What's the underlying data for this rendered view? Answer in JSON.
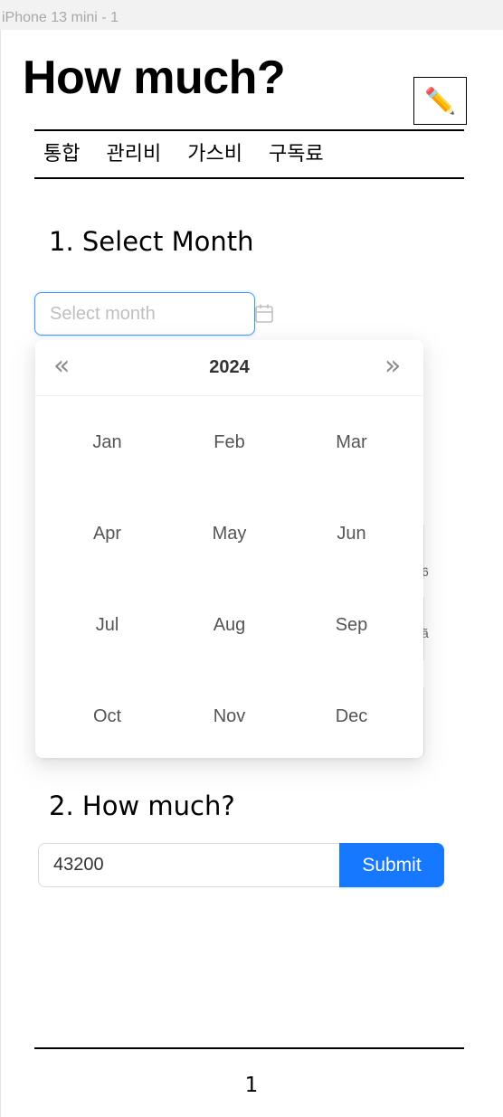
{
  "frame_label": "iPhone 13 mini - 1",
  "header": {
    "title": "How much?",
    "edit_icon": "pencil-icon",
    "edit_glyph": "✏️"
  },
  "nav": {
    "items": [
      "통합",
      "관리비",
      "가스비",
      "구독료"
    ]
  },
  "section1": {
    "title": "1. Select Month",
    "month_input": {
      "placeholder": "Select month",
      "value": "",
      "icon": "calendar-icon"
    },
    "picker": {
      "prev_glyph": "«",
      "next_glyph": "»",
      "year": "2024",
      "months": [
        "Jan",
        "Feb",
        "Mar",
        "Apr",
        "May",
        "Jun",
        "Jul",
        "Aug",
        "Sep",
        "Oct",
        "Nov",
        "Dec"
      ]
    },
    "ghost_chars": [
      "6",
      "ã"
    ]
  },
  "section2": {
    "title": "2. How much?",
    "amount_value": "43200",
    "submit_label": "Submit"
  },
  "footer": {
    "page_number": "1"
  },
  "colors": {
    "accent": "#1677ff",
    "focus_border": "#4096ff",
    "placeholder": "#bfbfbf"
  }
}
